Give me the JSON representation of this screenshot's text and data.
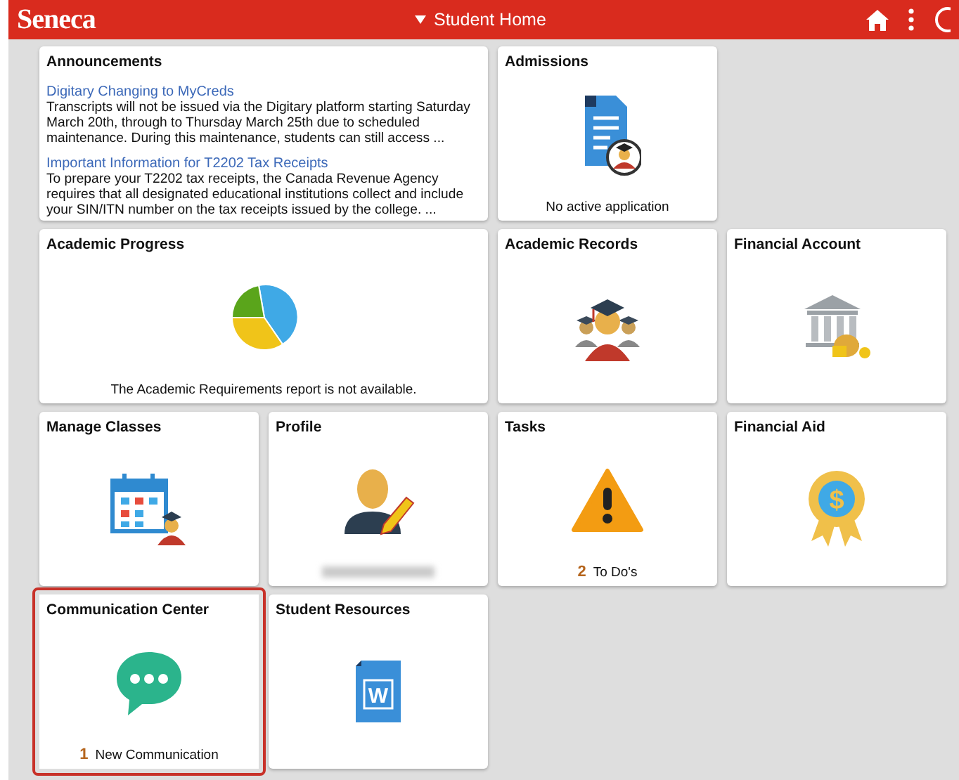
{
  "header": {
    "logo": "Seneca",
    "title": "Student Home"
  },
  "tiles": [
    {
      "kind": "announcements",
      "title": "Announcements",
      "highlighted": false,
      "items": [
        {
          "link": "Digitary Changing to MyCreds",
          "text": "Transcripts will not be issued via the Digitary platform starting Saturday March 20th, through to Thursday March 25th due to scheduled maintenance. During this maintenance, students can still access ..."
        },
        {
          "link": "Important Information for T2202 Tax Receipts",
          "text": "To prepare your T2202 tax receipts, the Canada Revenue Agency requires that all designated educational institutions collect and include your SIN/ITN number on the tax receipts issued by the college. ..."
        }
      ]
    },
    {
      "kind": "admissions",
      "title": "Admissions",
      "highlighted": false,
      "footer": {
        "text": "No active application"
      }
    },
    {
      "kind": "progress",
      "title": "Academic Progress",
      "highlighted": false,
      "footer": {
        "text": "The Academic Requirements report is not available."
      }
    },
    {
      "kind": "records",
      "title": "Academic Records",
      "highlighted": false
    },
    {
      "kind": "finance",
      "title": "Financial Account",
      "highlighted": false
    },
    {
      "kind": "classes",
      "title": "Manage Classes",
      "highlighted": false
    },
    {
      "kind": "profile",
      "title": "Profile",
      "highlighted": false,
      "footer": {
        "redacted": true
      }
    },
    {
      "kind": "tasks",
      "title": "Tasks",
      "highlighted": false,
      "footer": {
        "count": "2",
        "text": "To Do's"
      }
    },
    {
      "kind": "aid",
      "title": "Financial Aid",
      "highlighted": false,
      "icon_label": "$"
    },
    {
      "kind": "communication",
      "title": "Communication Center",
      "highlighted": true,
      "footer": {
        "count": "1",
        "text": "New Communication"
      }
    },
    {
      "kind": "resources",
      "title": "Student Resources",
      "highlighted": false,
      "icon_label": "W"
    }
  ]
}
